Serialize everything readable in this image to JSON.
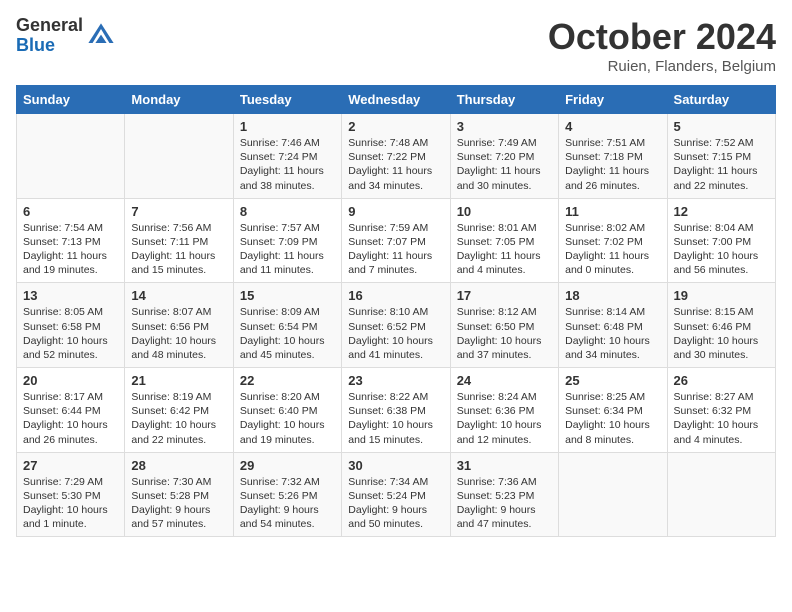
{
  "header": {
    "logo_general": "General",
    "logo_blue": "Blue",
    "month_title": "October 2024",
    "location": "Ruien, Flanders, Belgium"
  },
  "days_of_week": [
    "Sunday",
    "Monday",
    "Tuesday",
    "Wednesday",
    "Thursday",
    "Friday",
    "Saturday"
  ],
  "weeks": [
    [
      {
        "day": "",
        "info": ""
      },
      {
        "day": "",
        "info": ""
      },
      {
        "day": "1",
        "info": "Sunrise: 7:46 AM\nSunset: 7:24 PM\nDaylight: 11 hours and 38 minutes."
      },
      {
        "day": "2",
        "info": "Sunrise: 7:48 AM\nSunset: 7:22 PM\nDaylight: 11 hours and 34 minutes."
      },
      {
        "day": "3",
        "info": "Sunrise: 7:49 AM\nSunset: 7:20 PM\nDaylight: 11 hours and 30 minutes."
      },
      {
        "day": "4",
        "info": "Sunrise: 7:51 AM\nSunset: 7:18 PM\nDaylight: 11 hours and 26 minutes."
      },
      {
        "day": "5",
        "info": "Sunrise: 7:52 AM\nSunset: 7:15 PM\nDaylight: 11 hours and 22 minutes."
      }
    ],
    [
      {
        "day": "6",
        "info": "Sunrise: 7:54 AM\nSunset: 7:13 PM\nDaylight: 11 hours and 19 minutes."
      },
      {
        "day": "7",
        "info": "Sunrise: 7:56 AM\nSunset: 7:11 PM\nDaylight: 11 hours and 15 minutes."
      },
      {
        "day": "8",
        "info": "Sunrise: 7:57 AM\nSunset: 7:09 PM\nDaylight: 11 hours and 11 minutes."
      },
      {
        "day": "9",
        "info": "Sunrise: 7:59 AM\nSunset: 7:07 PM\nDaylight: 11 hours and 7 minutes."
      },
      {
        "day": "10",
        "info": "Sunrise: 8:01 AM\nSunset: 7:05 PM\nDaylight: 11 hours and 4 minutes."
      },
      {
        "day": "11",
        "info": "Sunrise: 8:02 AM\nSunset: 7:02 PM\nDaylight: 11 hours and 0 minutes."
      },
      {
        "day": "12",
        "info": "Sunrise: 8:04 AM\nSunset: 7:00 PM\nDaylight: 10 hours and 56 minutes."
      }
    ],
    [
      {
        "day": "13",
        "info": "Sunrise: 8:05 AM\nSunset: 6:58 PM\nDaylight: 10 hours and 52 minutes."
      },
      {
        "day": "14",
        "info": "Sunrise: 8:07 AM\nSunset: 6:56 PM\nDaylight: 10 hours and 48 minutes."
      },
      {
        "day": "15",
        "info": "Sunrise: 8:09 AM\nSunset: 6:54 PM\nDaylight: 10 hours and 45 minutes."
      },
      {
        "day": "16",
        "info": "Sunrise: 8:10 AM\nSunset: 6:52 PM\nDaylight: 10 hours and 41 minutes."
      },
      {
        "day": "17",
        "info": "Sunrise: 8:12 AM\nSunset: 6:50 PM\nDaylight: 10 hours and 37 minutes."
      },
      {
        "day": "18",
        "info": "Sunrise: 8:14 AM\nSunset: 6:48 PM\nDaylight: 10 hours and 34 minutes."
      },
      {
        "day": "19",
        "info": "Sunrise: 8:15 AM\nSunset: 6:46 PM\nDaylight: 10 hours and 30 minutes."
      }
    ],
    [
      {
        "day": "20",
        "info": "Sunrise: 8:17 AM\nSunset: 6:44 PM\nDaylight: 10 hours and 26 minutes."
      },
      {
        "day": "21",
        "info": "Sunrise: 8:19 AM\nSunset: 6:42 PM\nDaylight: 10 hours and 22 minutes."
      },
      {
        "day": "22",
        "info": "Sunrise: 8:20 AM\nSunset: 6:40 PM\nDaylight: 10 hours and 19 minutes."
      },
      {
        "day": "23",
        "info": "Sunrise: 8:22 AM\nSunset: 6:38 PM\nDaylight: 10 hours and 15 minutes."
      },
      {
        "day": "24",
        "info": "Sunrise: 8:24 AM\nSunset: 6:36 PM\nDaylight: 10 hours and 12 minutes."
      },
      {
        "day": "25",
        "info": "Sunrise: 8:25 AM\nSunset: 6:34 PM\nDaylight: 10 hours and 8 minutes."
      },
      {
        "day": "26",
        "info": "Sunrise: 8:27 AM\nSunset: 6:32 PM\nDaylight: 10 hours and 4 minutes."
      }
    ],
    [
      {
        "day": "27",
        "info": "Sunrise: 7:29 AM\nSunset: 5:30 PM\nDaylight: 10 hours and 1 minute."
      },
      {
        "day": "28",
        "info": "Sunrise: 7:30 AM\nSunset: 5:28 PM\nDaylight: 9 hours and 57 minutes."
      },
      {
        "day": "29",
        "info": "Sunrise: 7:32 AM\nSunset: 5:26 PM\nDaylight: 9 hours and 54 minutes."
      },
      {
        "day": "30",
        "info": "Sunrise: 7:34 AM\nSunset: 5:24 PM\nDaylight: 9 hours and 50 minutes."
      },
      {
        "day": "31",
        "info": "Sunrise: 7:36 AM\nSunset: 5:23 PM\nDaylight: 9 hours and 47 minutes."
      },
      {
        "day": "",
        "info": ""
      },
      {
        "day": "",
        "info": ""
      }
    ]
  ]
}
